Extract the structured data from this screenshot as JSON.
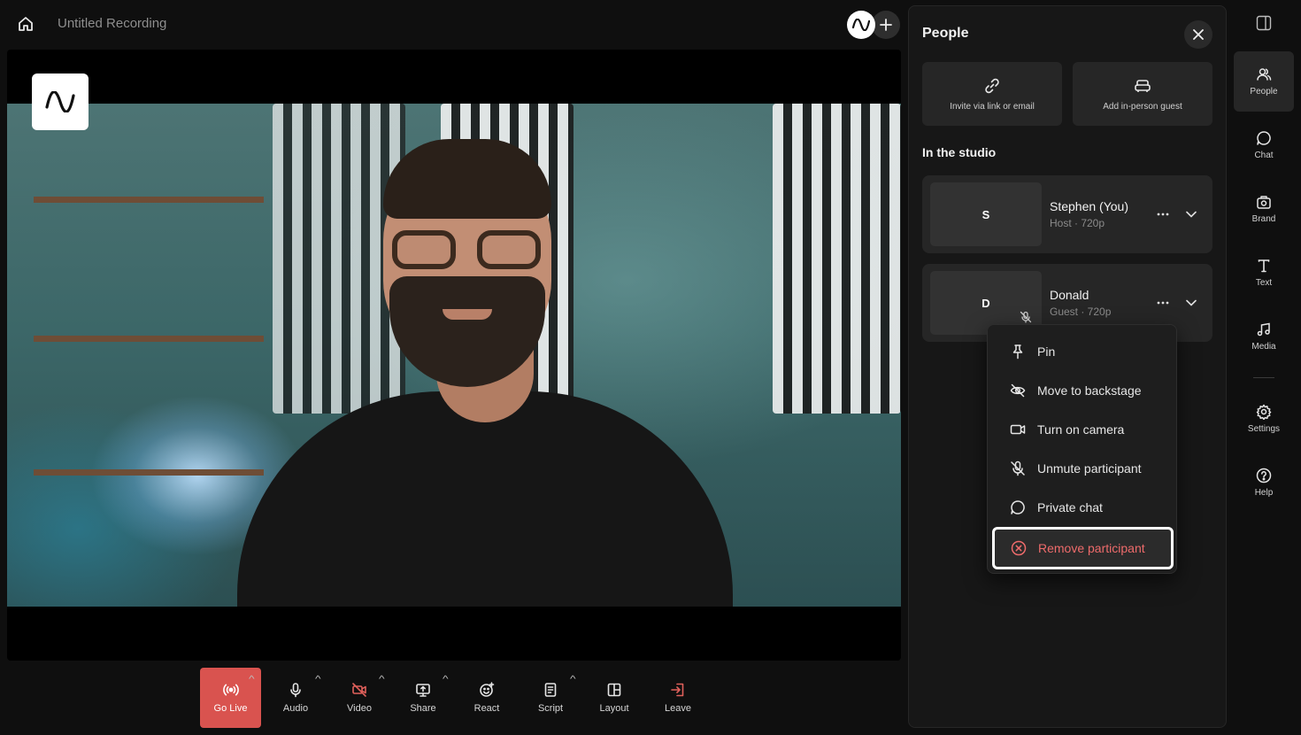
{
  "header": {
    "title": "Untitled Recording"
  },
  "controls": [
    {
      "label": "Go Live",
      "icon": "broadcast-icon"
    },
    {
      "label": "Audio",
      "icon": "microphone-icon"
    },
    {
      "label": "Video",
      "icon": "camera-off-icon"
    },
    {
      "label": "Share",
      "icon": "screen-share-icon"
    },
    {
      "label": "React",
      "icon": "emoji-icon"
    },
    {
      "label": "Script",
      "icon": "script-icon"
    },
    {
      "label": "Layout",
      "icon": "layout-icon"
    },
    {
      "label": "Leave",
      "icon": "exit-icon"
    }
  ],
  "people_panel": {
    "title": "People",
    "actions": [
      {
        "label": "Invite via link or email",
        "icon": "link-icon"
      },
      {
        "label": "Add in-person guest",
        "icon": "sofa-icon"
      }
    ],
    "section_title": "In the studio",
    "participants": [
      {
        "initial": "S",
        "name": "Stephen (You)",
        "meta": "Host · 720p"
      },
      {
        "initial": "D",
        "name": "Donald",
        "meta": "Guest · 720p"
      }
    ]
  },
  "context_menu": {
    "items": [
      {
        "label": "Pin",
        "icon": "pin-icon"
      },
      {
        "label": "Move to backstage",
        "icon": "eye-off-icon"
      },
      {
        "label": "Turn on camera",
        "icon": "camera-icon"
      },
      {
        "label": "Unmute participant",
        "icon": "mic-off-icon"
      },
      {
        "label": "Private chat",
        "icon": "chat-bubble-icon"
      },
      {
        "label": "Remove participant",
        "icon": "remove-circle-icon"
      }
    ]
  },
  "rail": [
    {
      "label": "People",
      "icon": "people-icon"
    },
    {
      "label": "Chat",
      "icon": "chat-icon"
    },
    {
      "label": "Brand",
      "icon": "brand-icon"
    },
    {
      "label": "Text",
      "icon": "text-icon"
    },
    {
      "label": "Media",
      "icon": "music-note-icon"
    },
    {
      "label": "Settings",
      "icon": "gear-icon"
    },
    {
      "label": "Help",
      "icon": "help-icon"
    }
  ],
  "colors": {
    "accent_live": "#d9534f",
    "danger_text": "#ee6b6b"
  }
}
